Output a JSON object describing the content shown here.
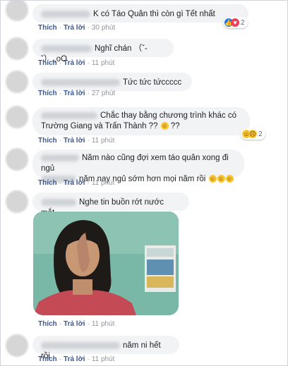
{
  "labels": {
    "like": "Thích",
    "reply": "Trả lời",
    "separator": "·"
  },
  "comments": [
    {
      "text": "K có Táo Quân thì còn gì Tết nhất",
      "time": "30 phút",
      "reaction_count": "2",
      "reaction_icons": [
        "like-icon",
        "heart-icon"
      ]
    },
    {
      "text": "Nghĩ chán （ˇ-ˇ）.,oO",
      "time": "11 phút"
    },
    {
      "text": "Tức tức tứccccc",
      "time": "27 phút"
    },
    {
      "text_line1": "Chắc thay bằng chương trình khác có",
      "text_line2": "Trường Giang và Trấn Thành ??",
      "line2_suffix": "??",
      "line2_emoji": "grinning-emoji",
      "time": "11 phút",
      "reaction_count": "2",
      "reaction_icons": [
        "haha-icon",
        "sad-icon"
      ]
    },
    {
      "text_line1": "Năm nào cũng đợi xem táo quân xong đi ngủ",
      "text_line2": "năm nay ngủ sớm hơn mọi năm rồi",
      "line2_emojis": [
        "laughing-emoji",
        "laughing-emoji",
        "laughing-emoji"
      ],
      "time": "11 phút"
    },
    {
      "text": "Nghe tin buồn rớt nước mắt...",
      "time": "11 phút",
      "has_photo": true
    },
    {
      "text": "năm ni hết rồi",
      "time": "11 phút"
    }
  ],
  "colors": {
    "link": "#385898",
    "meta": "#90949c",
    "bubble": "#f2f3f5",
    "like": "#1877f2",
    "heart": "#f33e58",
    "haha": "#f7c531"
  }
}
